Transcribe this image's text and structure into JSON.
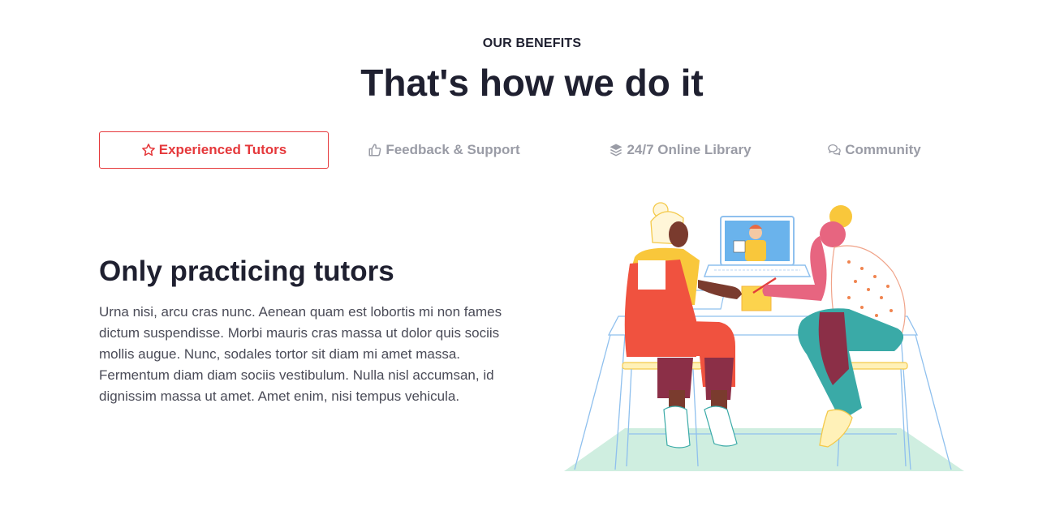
{
  "section": {
    "eyebrow": "OUR BENEFITS",
    "headline": "That's how we do it"
  },
  "tabs": [
    {
      "label": "Experienced Tutors",
      "icon": "star-icon",
      "active": true
    },
    {
      "label": "Feedback & Support",
      "icon": "thumbs-up-icon",
      "active": false
    },
    {
      "label": "24/7 Online Library",
      "icon": "layers-icon",
      "active": false
    },
    {
      "label": "Community",
      "icon": "chat-bubbles-icon",
      "active": false
    }
  ],
  "content": {
    "title": "Only practicing tutors",
    "body": "Urna nisi, arcu cras nunc. Aenean quam est lobortis mi non fames dictum suspendisse. Morbi mauris cras massa ut dolor quis sociis mollis augue. Nunc, sodales tortor sit diam mi amet massa. Fermentum diam diam sociis vestibulum. Nulla nisl accumsan, id dignissim massa ut amet. Amet enim, nisi tempus vehicula.",
    "illustration": "tutoring-session-illustration"
  },
  "colors": {
    "accent": "#e5383b",
    "text_dark": "#1f2030",
    "text_muted": "#9a9ca6",
    "body_text": "#4a4b57"
  }
}
